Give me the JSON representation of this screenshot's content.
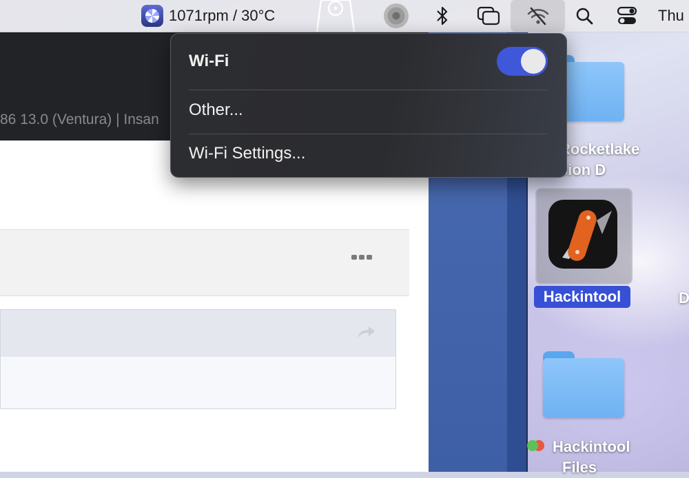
{
  "menubar": {
    "fan_status": "1071rpm / 30°C",
    "clock": "Thu"
  },
  "background_window": {
    "title_fragment": "86 13.0 (Ventura) | Insan"
  },
  "wifi_menu": {
    "title": "Wi-Fi",
    "toggle_on": true,
    "items": [
      {
        "label": "Other..."
      },
      {
        "label": "Wi-Fi Settings..."
      }
    ]
  },
  "desktop": {
    "folder_top_label_line1": "Rocketlake",
    "folder_top_label_line2": "sion D",
    "selected_app_label": "Hackintool",
    "folder_bottom_label_line1": "Hackintool",
    "folder_bottom_label_line2": "Files",
    "partial_right_label": "D"
  },
  "colors": {
    "accent": "#3f57d9",
    "menu_bg": "#2c2d30",
    "selection": "#3750d6"
  }
}
